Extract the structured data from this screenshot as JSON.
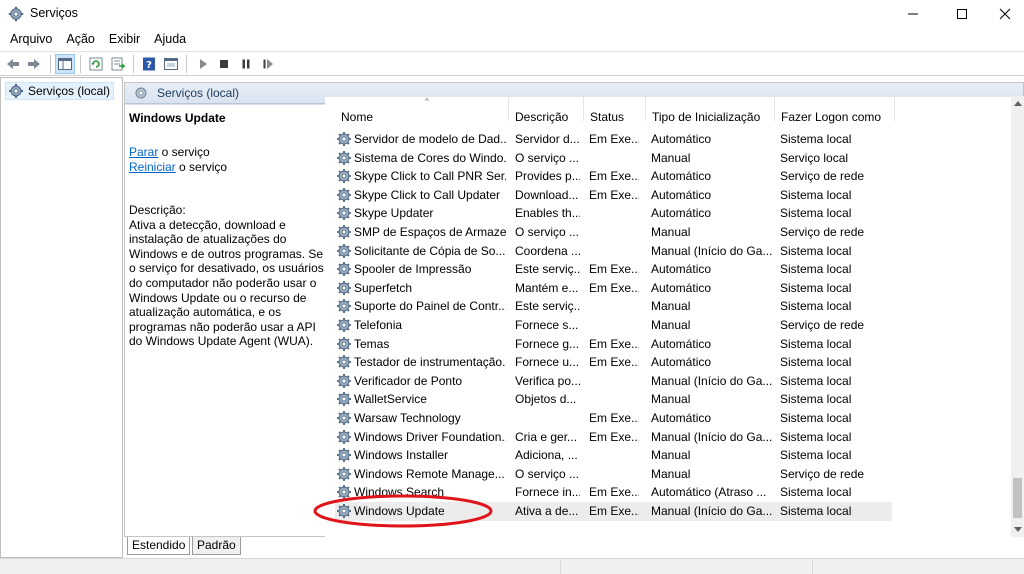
{
  "window": {
    "title": "Serviços",
    "minimize_glyph": "—",
    "close_glyph": "✕"
  },
  "menu": [
    "Arquivo",
    "Ação",
    "Exibir",
    "Ajuda"
  ],
  "tree": {
    "root_label": "Serviços (local)"
  },
  "pane": {
    "header_title": "Serviços (local)"
  },
  "details": {
    "service_name": "Windows Update",
    "action1_link": "Parar",
    "action1_rest": " o serviço",
    "action2_link": "Reiniciar",
    "action2_rest": " o serviço",
    "description_label": "Descrição:",
    "description_text": "Ativa a detecção, download e instalação de atualizações do Windows e de outros programas. Se o serviço for desativado, os usuários do computador não poderão usar o Windows Update ou o recurso de atualização automática, e os programas não poderão usar a API do Windows Update Agent (WUA)."
  },
  "columns": {
    "name": "Nome",
    "description": "Descrição",
    "status": "Status",
    "startup": "Tipo de Inicialização",
    "logon": "Fazer Logon como"
  },
  "rows": [
    {
      "name": "Servidor de modelo de Dad...",
      "desc": "Servidor d...",
      "status": "Em Exe...",
      "tipo": "Automático",
      "logon": "Sistema local"
    },
    {
      "name": "Sistema de Cores do Windo...",
      "desc": "O serviço ...",
      "status": "",
      "tipo": "Manual",
      "logon": "Serviço local"
    },
    {
      "name": "Skype Click to Call PNR Ser...",
      "desc": "Provides p...",
      "status": "Em Exe...",
      "tipo": "Automático",
      "logon": "Serviço de rede"
    },
    {
      "name": "Skype Click to Call Updater",
      "desc": "Download...",
      "status": "Em Exe...",
      "tipo": "Automático",
      "logon": "Sistema local"
    },
    {
      "name": "Skype Updater",
      "desc": "Enables th...",
      "status": "",
      "tipo": "Automático",
      "logon": "Sistema local"
    },
    {
      "name": "SMP de Espaços de Armaze...",
      "desc": "O serviço ...",
      "status": "",
      "tipo": "Manual",
      "logon": "Serviço de rede"
    },
    {
      "name": "Solicitante de Cópia de So...",
      "desc": "Coordena ...",
      "status": "",
      "tipo": "Manual (Início do Ga...",
      "logon": "Sistema local"
    },
    {
      "name": "Spooler de Impressão",
      "desc": "Este serviç...",
      "status": "Em Exe...",
      "tipo": "Automático",
      "logon": "Sistema local"
    },
    {
      "name": "Superfetch",
      "desc": "Mantém e...",
      "status": "Em Exe...",
      "tipo": "Automático",
      "logon": "Sistema local"
    },
    {
      "name": "Suporte do Painel de Contr...",
      "desc": "Este serviç...",
      "status": "",
      "tipo": "Manual",
      "logon": "Sistema local"
    },
    {
      "name": "Telefonia",
      "desc": "Fornece s...",
      "status": "",
      "tipo": "Manual",
      "logon": "Serviço de rede"
    },
    {
      "name": "Temas",
      "desc": "Fornece g...",
      "status": "Em Exe...",
      "tipo": "Automático",
      "logon": "Sistema local"
    },
    {
      "name": "Testador de instrumentação...",
      "desc": "Fornece u...",
      "status": "Em Exe...",
      "tipo": "Automático",
      "logon": "Sistema local"
    },
    {
      "name": "Verificador de Ponto",
      "desc": "Verifica po...",
      "status": "",
      "tipo": "Manual (Início do Ga...",
      "logon": "Sistema local"
    },
    {
      "name": "WalletService",
      "desc": "Objetos d...",
      "status": "",
      "tipo": "Manual",
      "logon": "Sistema local"
    },
    {
      "name": "Warsaw Technology",
      "desc": "",
      "status": "Em Exe...",
      "tipo": "Automático",
      "logon": "Sistema local"
    },
    {
      "name": "Windows Driver Foundation...",
      "desc": "Cria e ger...",
      "status": "Em Exe...",
      "tipo": "Manual (Início do Ga...",
      "logon": "Sistema local"
    },
    {
      "name": "Windows Installer",
      "desc": "Adiciona, ...",
      "status": "",
      "tipo": "Manual",
      "logon": "Sistema local"
    },
    {
      "name": "Windows Remote Manage...",
      "desc": "O serviço ...",
      "status": "",
      "tipo": "Manual",
      "logon": "Serviço de rede"
    },
    {
      "name": "Windows Search",
      "desc": "Fornece in...",
      "status": "Em Exe...",
      "tipo": "Automático (Atraso ...",
      "logon": "Sistema local"
    },
    {
      "name": "Windows Update",
      "desc": "Ativa a de...",
      "status": "Em Exe...",
      "tipo": "Manual (Início do Ga...",
      "logon": "Sistema local",
      "selected": true
    }
  ],
  "tabs": [
    "Estendido",
    "Padrão"
  ],
  "colors": {
    "link": "#0066cc",
    "annotation": "#e0141b",
    "header_bg": "#dfe8f2",
    "selected_row": "#ececec"
  },
  "icons": {
    "app": "gear-icon",
    "row": "gear-icon"
  }
}
